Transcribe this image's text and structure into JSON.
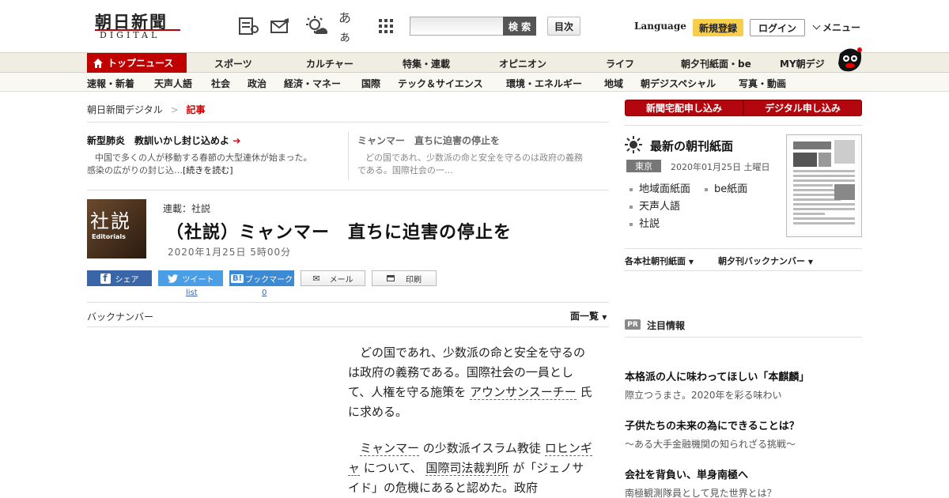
{
  "header": {
    "logo_main": "朝日新聞",
    "logo_sub": "DIGITAL",
    "icons": [
      "newspaper-icon",
      "mail-icon",
      "weather-sun-icon",
      "font-size-icon",
      "grid-menu-icon"
    ],
    "font_size_label": "あぁ",
    "search_placeholder": "",
    "search_button": "検 索",
    "toc_button": "目次",
    "language": "Language",
    "register": "新規登録",
    "login": "ログイン",
    "menu": "メニュー"
  },
  "nav1": {
    "top": "トップニュース",
    "items": [
      "スポーツ",
      "カルチャー",
      "特集・連載",
      "オピニオン",
      "ライフ",
      "朝夕刊紙面・be",
      "MY朝デジ"
    ]
  },
  "nav2": {
    "items": [
      "速報・新着",
      "天声人語",
      "社会",
      "政治",
      "経済・マネー",
      "国際",
      "テック＆サイエンス",
      "環境・エネルギー",
      "地域",
      "朝デジスペシャル",
      "写真・動画"
    ]
  },
  "breadcrumb": {
    "home": "朝日新聞デジタル",
    "sep": ">",
    "current": "記事"
  },
  "picks": [
    {
      "title": "新型肺炎　教訓いかし封じ込めよ",
      "summary1": "中国で多くの人が移動する春節の大型連休が始まった。",
      "summary2": "感染の広がりの封じ込…",
      "more": "[続きを読む]"
    },
    {
      "title": "ミャンマー　直ちに迫害の停止を",
      "summary1": "どの国であれ、少数派の命と安全を守るのは政府の義務",
      "summary2": "である。国際社会の一…"
    }
  ],
  "article": {
    "badge_main": "社説",
    "badge_sub": "Editorials",
    "series": "連載：社説",
    "title": "（社説）ミャンマー　直ちに迫害の停止を",
    "date": "2020年1月25日 5時00分",
    "share": {
      "facebook": "シェア",
      "twitter": "ツイート",
      "twitter_sub": "list",
      "hatena": "ブックマーク",
      "hatena_count": "0",
      "mail": "メール",
      "print": "印刷"
    },
    "backnumber": "バックナンバー",
    "page_list": "面一覧",
    "p1": {
      "a": "どの国であれ、少数派の命と安全を守るのは政府の義務である。国際社会の一員として、人権を守る施策を",
      "kw1": "アウンサンスーチー",
      "b": "氏に求める。"
    },
    "p2": {
      "kw1": "ミャンマー",
      "a": "の少数派イスラム教徒",
      "kw2": "ロヒンギャ",
      "b": "について、",
      "kw3": "国際司法裁判所",
      "c": "が「ジェノサイド」の危機にあると認めた。政府"
    }
  },
  "sidebar": {
    "btn_delivery": "新聞宅配申し込み",
    "btn_digital": "デジタル申し込み",
    "paper_title": "最新の朝刊紙面",
    "region": "東京",
    "paper_date": "2020年01月25日 土曜日",
    "links": [
      "地域面紙面",
      "be紙面",
      "天声人語",
      "社説"
    ],
    "dd1": "各本社朝刊紙面",
    "dd2": "朝夕刊バックナンバー",
    "pr_badge": "PR",
    "pr_title": "注目情報",
    "ads": [
      {
        "title": "本格派の人に味わってほしい「本麒麟」",
        "sub": "際立つうまさ。2020年を彩る味わい"
      },
      {
        "title": "子供たちの未来の為にできることは？",
        "sub": "～ある大手金融機関の知られざる挑戦～"
      },
      {
        "title": "会社を背負い、単身南極へ",
        "sub": "南極観測隊員として見た世界とは？"
      }
    ]
  },
  "colors": {
    "brand_red": "#c00000",
    "nav_bg": "#f0ede2",
    "register_yellow": "#f7ce4a"
  }
}
